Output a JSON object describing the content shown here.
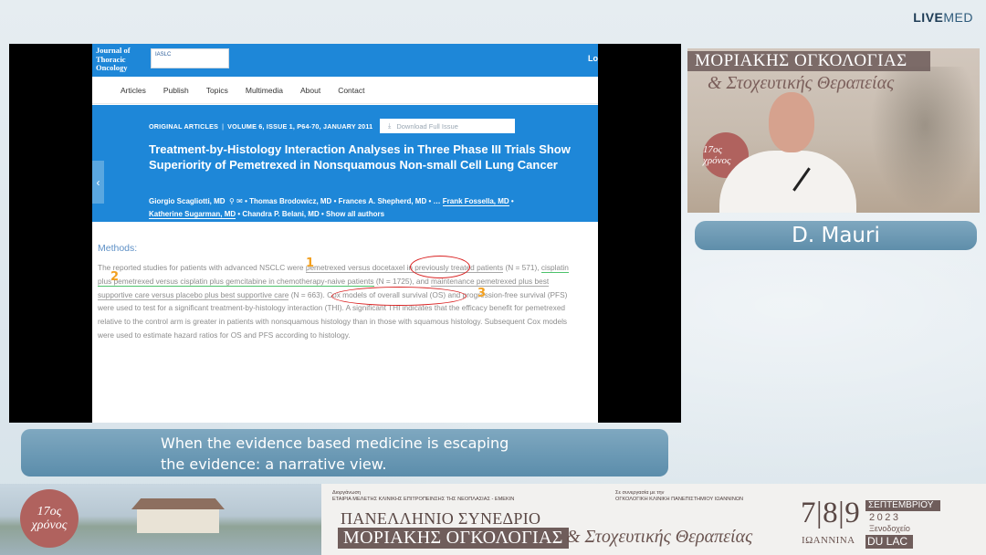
{
  "brand": {
    "bold": "LIVE",
    "light": "MED"
  },
  "slide": {
    "journal_logo": "Journal of Thoracic Oncology",
    "partner_logo": "IASLC",
    "login": "Lo",
    "nav": [
      "Articles",
      "Publish",
      "Topics",
      "Multimedia",
      "About",
      "Contact"
    ],
    "meta": {
      "section": "ORIGINAL ARTICLES",
      "volume": "VOLUME 6, ISSUE 1, P64-70, JANUARY 2011",
      "download": "Download Full Issue"
    },
    "title": "Treatment-by-Histology Interaction Analyses in Three Phase III Trials Show Superiority of Pemetrexed in Nonsquamous Non-small Cell Lung Cancer",
    "authors": {
      "a1": "Giorgio Scagliotti, MD",
      "a2": "Thomas Brodowicz, MD",
      "a3": "Frances A. Shepherd, MD",
      "ell": "…",
      "a4": "Frank Fossella, MD",
      "a5": "Katherine Sugarman, MD",
      "a6": "Chandra P. Belani, MD",
      "show_all": "Show all authors"
    },
    "methods_heading": "Methods:",
    "abstract": {
      "p1": "The reported studies for patients with advanced NSCLC were ",
      "p2": "pemetrexed versus docetaxel in previously treated patients",
      "p3": " (N = 571), ",
      "p4": "cisplatin plus pemetrexed versus cisplatin plus gemcitabine in chemotherapy-naive patients",
      "p5": " (N = 1725), and ",
      "p6": "maintenance pemetrexed plus best supportive care versus placebo plus best supportive care",
      "p7": " (N = 663). Cox models of overall survival (OS) and progression-free survival (PFS) were used to test for a significant treatment-by-histology interaction (THI). A significant THI indicates that the efficacy benefit for pemetrexed relative to the control arm is greater in patients with nonsquamous histology than in those with squamous histology. Subsequent Cox models were used to estimate hazard ratios for OS and PFS according to histology."
    },
    "marks": [
      "1",
      "2",
      "3"
    ]
  },
  "speaker_video": {
    "banner": "ΜΟΡΙΑΚΗΣ ΟΓΚΟΛΟΓΙΑΣ",
    "sub": "& Στοχευτικής Θεραπείας",
    "seal": "17ος χρόνος"
  },
  "speaker_name": "D. Mauri",
  "caption": {
    "line1": "When the evidence based medicine is escaping",
    "line2": "the evidence: a narrative view."
  },
  "footer": {
    "seal_top": "17ος",
    "seal_bottom": "χρόνος",
    "org_left_label": "Διοργάνωση",
    "org_left": "ΕΤΑΙΡΙΑ ΜΕΛΕΤΗΣ ΚΛΙΝΙΚΗΣ ΕΠΙΤΡΟΠΕΙΝΣΗΣ ΤΗΣ ΝΕΟΠΛΑΣΙΑΣ - ΕΜΕΚΙΝ",
    "org_right_label": "Σε συνεργασία με την",
    "org_right": "ΟΓΚΟΛΟΓΙΚΗ ΚΛΙΝΙΚΗ ΠΑΝΕΠΙΣΤΗΜΙΟΥ ΙΩΑΝΝΙΝΩΝ",
    "title1": "ΠΑΝΕΛΛΗΝΙΟ ΣΥΝΕΔΡΙΟ",
    "title2": "ΜΟΡΙΑΚΗΣ ΟΓΚΟΛΟΓΙΑΣ",
    "title3": "& Στοχευτικής Θεραπείας",
    "days": "7|8|9",
    "month": "ΣΕΠΤΕΜΒΡΙΟΥ",
    "year": "2023",
    "venue": "Ξενοδοχείο",
    "city": "ΙΩΑΝΝΙΝΑ",
    "hotel": "DU LAC"
  },
  "colors": {
    "journal_blue": "#1e87d8",
    "caption_blue": "#6a98b4",
    "annotation_red": "#d92020",
    "annotation_orange": "#f2a020",
    "annotation_green": "#4cc26a"
  }
}
